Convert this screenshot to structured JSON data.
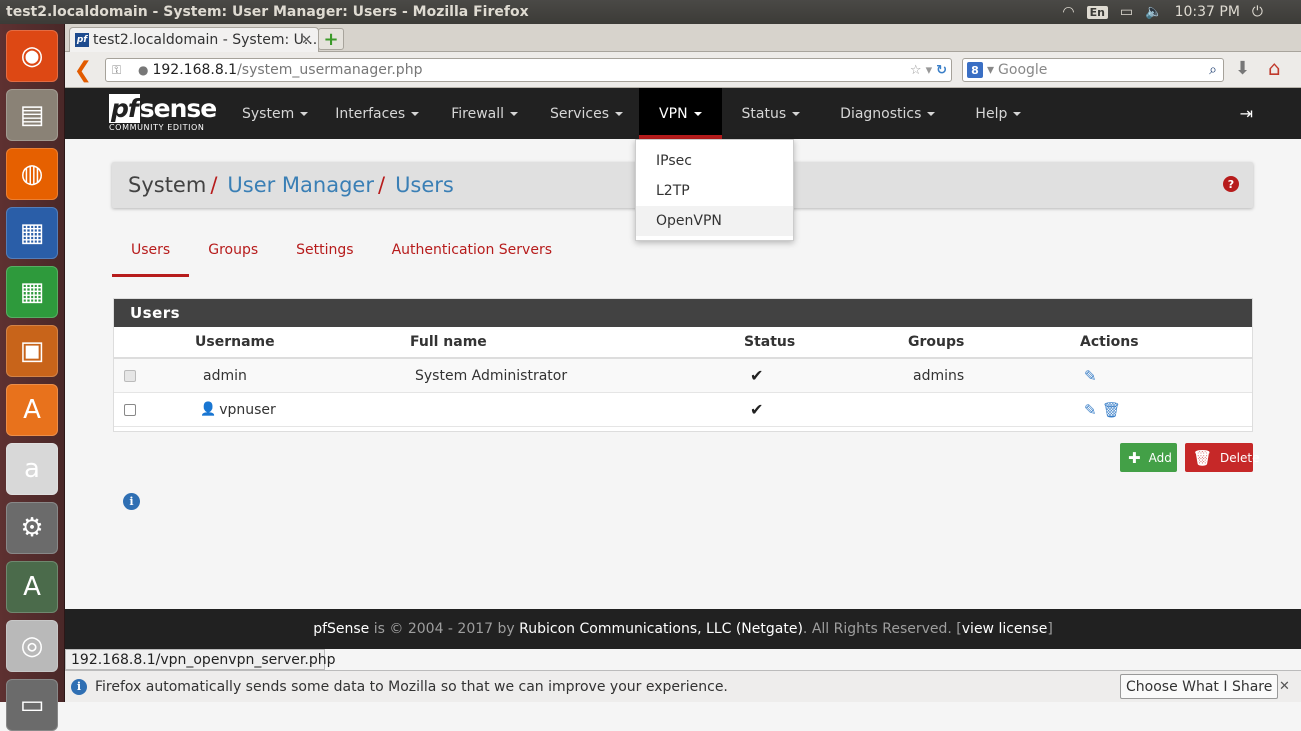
{
  "os": {
    "window_title": "test2.localdomain - System: User Manager: Users - Mozilla Firefox",
    "tray": {
      "lang": "En",
      "time": "10:37 PM"
    },
    "launcher": [
      {
        "name": "ubuntu-dash-icon",
        "glyph": "◉",
        "bg": "#dd4814"
      },
      {
        "name": "files-icon",
        "glyph": "▤",
        "bg": "#8a8276"
      },
      {
        "name": "firefox-icon",
        "glyph": "◍",
        "bg": "#e66000"
      },
      {
        "name": "writer-icon",
        "glyph": "▦",
        "bg": "#2a5ea8"
      },
      {
        "name": "calc-icon",
        "glyph": "▦",
        "bg": "#2e9a3c"
      },
      {
        "name": "impress-icon",
        "glyph": "▣",
        "bg": "#c8641a"
      },
      {
        "name": "software-center-icon",
        "glyph": "A",
        "bg": "#e8721c"
      },
      {
        "name": "amazon-icon",
        "glyph": "a",
        "bg": "#d8d8d8"
      },
      {
        "name": "settings-icon",
        "glyph": "⚙",
        "bg": "#6b6b6b"
      },
      {
        "name": "software-updater-icon",
        "glyph": "A",
        "bg": "#4b6b4b"
      },
      {
        "name": "dvd-icon",
        "glyph": "◎",
        "bg": "#b9b9b9"
      },
      {
        "name": "trash-icon",
        "glyph": "▭",
        "bg": "#6b6b6b"
      }
    ]
  },
  "browser": {
    "tab_title": "test2.localdomain - System: U...",
    "url_host": "192.168.8.1",
    "url_path": "/system_usermanager.php",
    "search_placeholder": "Google",
    "status_link": "192.168.8.1/vpn_openvpn_server.php",
    "notification": "Firefox automatically sends some data to Mozilla so that we can improve your experience.",
    "notification_button": "Choose What I Share"
  },
  "pfsense": {
    "logo": {
      "pf": "pf",
      "sense": "sense",
      "sub": "COMMUNITY EDITION"
    },
    "menu": [
      {
        "label": "System",
        "name": "menu-system"
      },
      {
        "label": "Interfaces",
        "name": "menu-interfaces"
      },
      {
        "label": "Firewall",
        "name": "menu-firewall"
      },
      {
        "label": "Services",
        "name": "menu-services"
      },
      {
        "label": "VPN",
        "name": "menu-vpn",
        "active": true
      },
      {
        "label": "Status",
        "name": "menu-status"
      },
      {
        "label": "Diagnostics",
        "name": "menu-diagnostics"
      },
      {
        "label": "Help",
        "name": "menu-help"
      }
    ],
    "vpn_dropdown": [
      "IPsec",
      "L2TP",
      "OpenVPN"
    ],
    "breadcrumb": {
      "root": "System",
      "level1": "User Manager",
      "level2": "Users"
    },
    "tabs": [
      "Users",
      "Groups",
      "Settings",
      "Authentication Servers"
    ],
    "panel_title": "Users",
    "table": {
      "headers": [
        "Username",
        "Full name",
        "Status",
        "Groups",
        "Actions"
      ],
      "rows": [
        {
          "username": "admin",
          "fullname": "System Administrator",
          "status": "✔",
          "groups": "admins"
        },
        {
          "username": "vpnuser",
          "fullname": "",
          "status": "✔",
          "groups": ""
        }
      ]
    },
    "buttons": {
      "add": "Add",
      "delete": "Delete"
    },
    "footer": {
      "a": "pfSense",
      "b": " is © 2004 - 2017 by ",
      "c": "Rubicon Communications, LLC (Netgate)",
      "d": ". All Rights Reserved. [",
      "e": "view license",
      "f": "]"
    },
    "colors": {
      "accent": "#b71c1c",
      "nav": "#212121",
      "link": "#3a7fb5"
    }
  }
}
